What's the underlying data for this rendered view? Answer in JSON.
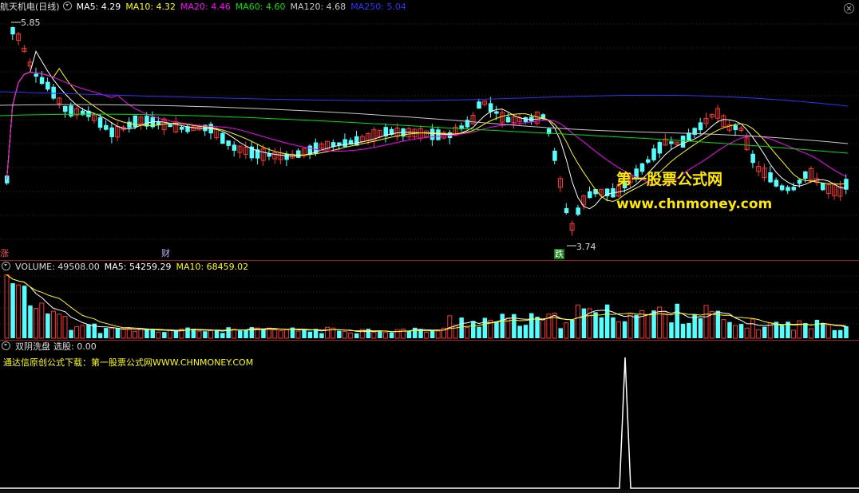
{
  "price_header": {
    "title": "航天机电(日线)",
    "ma5": "MA5: 4.29",
    "ma10": "MA10: 4.32",
    "ma20": "MA20: 4.46",
    "ma60": "MA60: 4.60",
    "ma120": "MA120: 4.68",
    "ma250": "MA250: 5.04"
  },
  "price_labels": {
    "high": "5.85",
    "low": "3.74",
    "tag_zhang": "涨",
    "tag_cai": "财",
    "tag_die": "跌"
  },
  "watermark": {
    "cn": "第一股票公式网",
    "url": "www.chnmoney.com"
  },
  "volume_header": {
    "volume": "VOLUME: 49508.00",
    "ma5": "MA5: 54259.29",
    "ma10": "MA10: 68459.02"
  },
  "indicator_header": {
    "name": "双阴洗盘",
    "value": "选股: 0.00",
    "note": "通达信原创公式下载：第一股票公式网WWW.CHNMONEY.COM"
  },
  "colors": {
    "up": "#ff3232",
    "down": "#54ffff",
    "ma5": "#ffffff",
    "ma10": "#ffff00",
    "ma20": "#ff00ff",
    "ma60": "#00e000",
    "ma120": "#c8c8c8",
    "ma250": "#3030ff"
  },
  "chart_data": {
    "type": "candlestick",
    "price_range": [
      3.74,
      5.85
    ],
    "indicator_signal_value": "0.00"
  }
}
